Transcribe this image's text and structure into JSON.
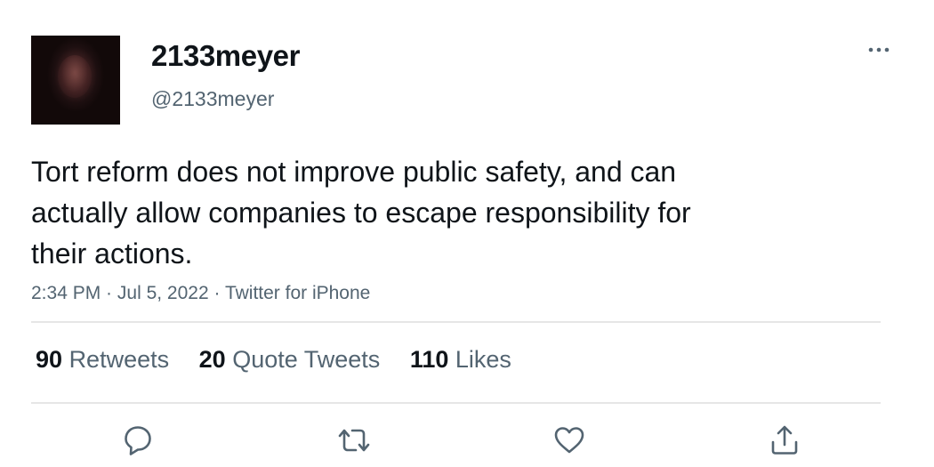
{
  "user": {
    "display_name": "2133meyer",
    "handle": "@2133meyer"
  },
  "tweet": {
    "text": "Tort reform does not improve public safety, and can\nactually allow companies to escape responsibility for\ntheir actions.",
    "time": "2:34 PM",
    "date": "Jul 5, 2022",
    "separator": " · ",
    "source": "Twitter for iPhone"
  },
  "stats": {
    "retweets_count": "90",
    "retweets_label": "Retweets",
    "quotes_count": "20",
    "quotes_label": "Quote Tweets",
    "likes_count": "110",
    "likes_label": "Likes"
  },
  "actions": {
    "reply_icon": "reply-icon",
    "retweet_icon": "retweet-icon",
    "like_icon": "heart-icon",
    "share_icon": "share-icon",
    "more_icon": "more-icon"
  },
  "colors": {
    "text_primary": "#0f1419",
    "text_secondary": "#536471",
    "divider": "#e6e6e6"
  }
}
